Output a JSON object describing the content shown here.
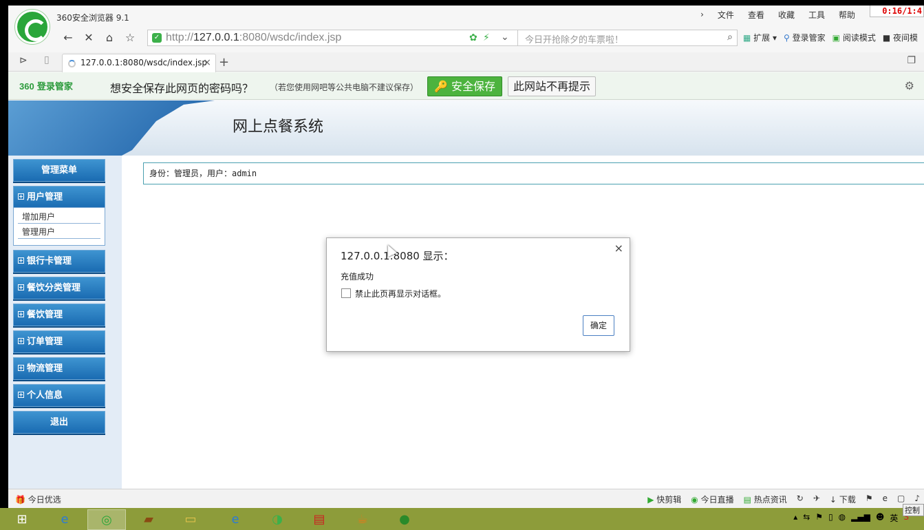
{
  "browser": {
    "app_title": "360安全浏览器 9.1",
    "menu": [
      "文件",
      "查看",
      "收藏",
      "工具",
      "帮助"
    ],
    "clock": "0:16/1:4",
    "address": {
      "url_scheme": "http://",
      "url_host": "127.0.0.1",
      "url_rest": ":8080/wsdc/index.jsp"
    },
    "search_placeholder": "今日开抢除夕的车票啦！",
    "extensions": [
      "扩展",
      "登录管家",
      "阅读模式",
      "夜间模"
    ],
    "tab": {
      "title": "127.0.0.1:8080/wsdc/index.jsp"
    }
  },
  "password_bar": {
    "brand_360": "360",
    "brand_text": "登录管家",
    "message": "想安全保存此网页的密码吗？",
    "note": "（若您使用网吧等公共电脑不建议保存）",
    "save_label": "安全保存",
    "never_label": "此网站不再提示"
  },
  "page": {
    "title": "网上点餐系统",
    "identity": "身份：管理员，用户：admin",
    "sidebar": {
      "header": "管理菜单",
      "groups": [
        "用户管理",
        "银行卡管理",
        "餐饮分类管理",
        "餐饮管理",
        "订单管理",
        "物流管理",
        "个人信息"
      ],
      "user_sub_items": [
        "增加用户",
        "管理用户"
      ],
      "logout": "退出"
    }
  },
  "dialog": {
    "title": "127.0.0.1:8080 显示：",
    "message": "充值成功",
    "checkbox_label": "禁止此页再显示对话框。",
    "ok_label": "确定"
  },
  "statusbar": {
    "left": "今日优选",
    "right": [
      "快剪辑",
      "今日直播",
      "热点资讯",
      "下载"
    ]
  },
  "taskbar": {
    "tray_lang": "英",
    "tray_ctrl": "控制"
  }
}
